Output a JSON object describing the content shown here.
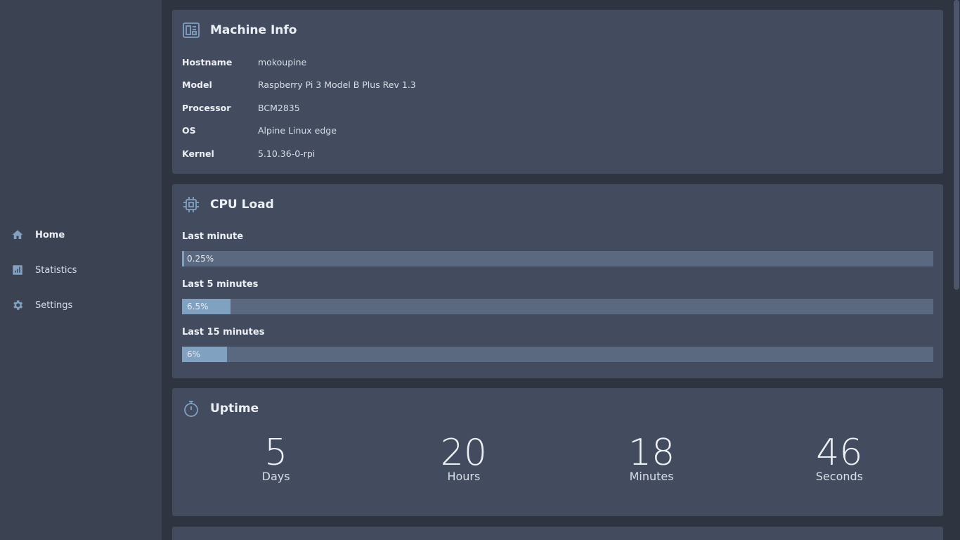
{
  "nav": {
    "items": [
      {
        "label": "Home",
        "icon": "home-icon",
        "active": true
      },
      {
        "label": "Statistics",
        "icon": "statistics-icon",
        "active": false
      },
      {
        "label": "Settings",
        "icon": "gear-icon",
        "active": false
      }
    ]
  },
  "machine_info": {
    "title": "Machine Info",
    "icon": "machine-icon",
    "rows": [
      {
        "key": "Hostname",
        "value": "mokoupine"
      },
      {
        "key": "Model",
        "value": "Raspberry Pi 3 Model B Plus Rev 1.3"
      },
      {
        "key": "Processor",
        "value": "BCM2835"
      },
      {
        "key": "OS",
        "value": "Alpine Linux edge"
      },
      {
        "key": "Kernel",
        "value": "5.10.36-0-rpi"
      }
    ]
  },
  "cpu_load": {
    "title": "CPU Load",
    "icon": "cpu-icon",
    "loads": [
      {
        "label": "Last minute",
        "text": "0.25%",
        "percent": 0.25
      },
      {
        "label": "Last 5 minutes",
        "text": "6.5%",
        "percent": 6.5
      },
      {
        "label": "Last 15 minutes",
        "text": "6%",
        "percent": 6
      }
    ]
  },
  "uptime": {
    "title": "Uptime",
    "icon": "stopwatch-icon",
    "units": [
      {
        "value": "5",
        "label": "Days"
      },
      {
        "value": "20",
        "label": "Hours"
      },
      {
        "value": "18",
        "label": "Minutes"
      },
      {
        "value": "46",
        "label": "Seconds"
      }
    ]
  },
  "colors": {
    "accent": "#81a1c1",
    "card_bg": "#434c5e",
    "sidebar_bg": "#3b4252",
    "page_bg": "#2e3440",
    "bar_track": "#5a6880"
  }
}
